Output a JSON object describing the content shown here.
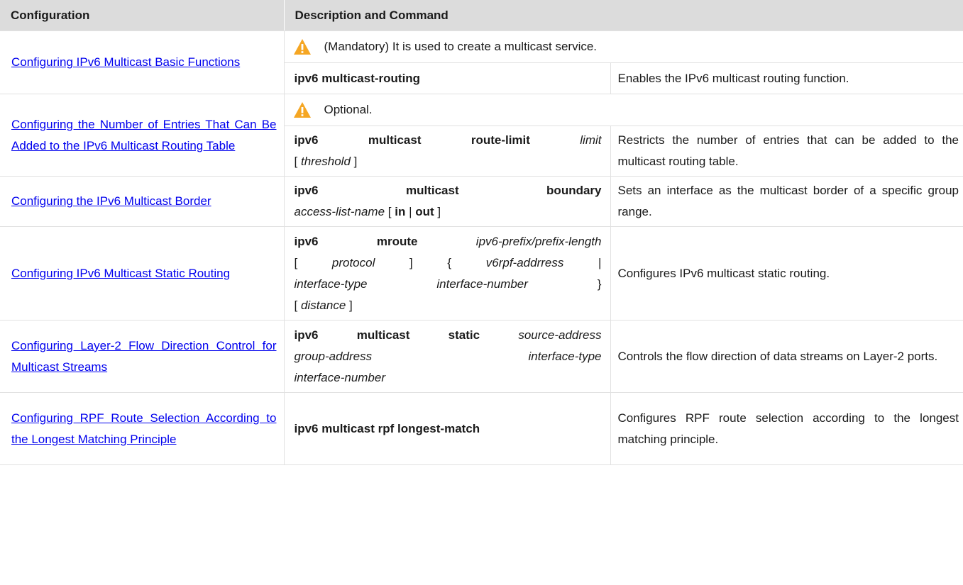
{
  "header": {
    "col1": "Configuration",
    "col2": "Description and Command"
  },
  "rows": [
    {
      "config_link": "Configuring IPv6 Multicast Basic Functions",
      "note": "(Mandatory) It is used to create a multicast service.",
      "command": "ipv6 multicast-routing",
      "description": "Enables the IPv6 multicast routing function."
    },
    {
      "config_link": "Configuring the Number of Entries That Can Be Added to the IPv6 Multicast Routing Table",
      "note": "Optional.",
      "command_parts": [
        "ipv6 multicast route-limit",
        "limit",
        "[",
        "threshold",
        "]"
      ],
      "description": "Restricts the number of entries that can be added to the multicast routing table."
    },
    {
      "config_link": "Configuring the IPv6 Multicast Border",
      "command_parts": [
        "ipv6 multicast boundary",
        "access-list-name",
        "[",
        "in",
        "|",
        "out",
        "]"
      ],
      "description": "Sets an interface as the multicast border of a specific group range."
    },
    {
      "config_link": "Configuring IPv6 Multicast Static Routing",
      "command_parts": [
        "ipv6 mroute",
        "ipv6-prefix/prefix-length",
        "[",
        "protocol",
        "]",
        "{",
        "v6rpf-addrress",
        "|",
        "interface-type",
        "interface-number",
        "}",
        "[",
        "distance",
        "]"
      ],
      "description": "Configures IPv6 multicast static routing."
    },
    {
      "config_link": "Configuring Layer-2 Flow Direction Control for Multicast Streams",
      "command_parts": [
        "ipv6 multicast static",
        "source-address",
        "group-address",
        "interface-type",
        "interface-number"
      ],
      "description": "Controls the flow direction of data streams on Layer-2 ports."
    },
    {
      "config_link": "Configuring RPF Route Selection According to the Longest Matching Principle",
      "command": "ipv6 multicast rpf longest-match",
      "description": "Configures RPF route selection according to the longest matching principle."
    }
  ]
}
